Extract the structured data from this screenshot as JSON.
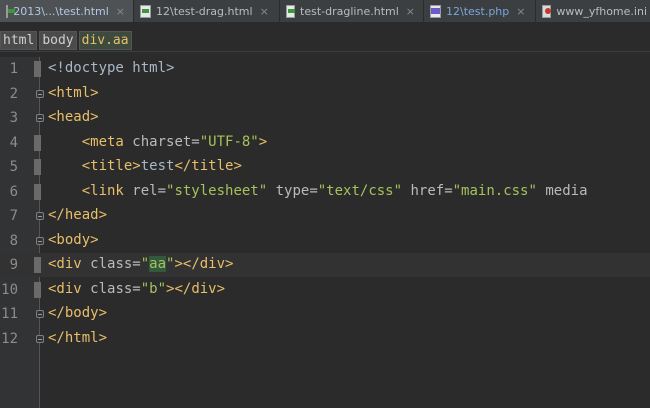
{
  "tabs": [
    {
      "label": "2013\\...\\test.html",
      "icon": "html-file-icon",
      "active": true
    },
    {
      "label": "12\\test-drag.html",
      "icon": "html-file-icon",
      "active": false
    },
    {
      "label": "test-dragline.html",
      "icon": "html-file-icon",
      "active": false
    },
    {
      "label": "12\\test.php",
      "icon": "php-file-icon",
      "active": false
    },
    {
      "label": "www_yfhome.ini",
      "icon": "web-file-icon",
      "active": false
    }
  ],
  "close_glyph": "×",
  "breadcrumb": [
    "html",
    "body",
    "div.aa"
  ],
  "code_lines": [
    {
      "n": "1",
      "parts": [
        [
          "txt",
          "<!doctype html>"
        ]
      ]
    },
    {
      "n": "2",
      "parts": [
        [
          "tag",
          "<html>"
        ]
      ]
    },
    {
      "n": "3",
      "parts": [
        [
          "tag",
          "<head>"
        ]
      ]
    },
    {
      "n": "4",
      "parts": [
        [
          "txt",
          "    "
        ],
        [
          "tag",
          "<meta "
        ],
        [
          "attr",
          "charset="
        ],
        [
          "val",
          "\"UTF-8\""
        ],
        [
          "tag",
          ">"
        ]
      ]
    },
    {
      "n": "5",
      "parts": [
        [
          "txt",
          "    "
        ],
        [
          "tag",
          "<title>"
        ],
        [
          "txt",
          "test"
        ],
        [
          "tag",
          "</title>"
        ]
      ]
    },
    {
      "n": "6",
      "parts": [
        [
          "txt",
          "    "
        ],
        [
          "tag",
          "<link "
        ],
        [
          "attr",
          "rel="
        ],
        [
          "val",
          "\"stylesheet\""
        ],
        [
          "attr",
          " type="
        ],
        [
          "val",
          "\"text/css\""
        ],
        [
          "attr",
          " href="
        ],
        [
          "val",
          "\"main.css\""
        ],
        [
          "attr",
          " media"
        ]
      ]
    },
    {
      "n": "7",
      "parts": [
        [
          "tag",
          "</head>"
        ]
      ]
    },
    {
      "n": "8",
      "parts": [
        [
          "tag",
          "<body>"
        ]
      ]
    },
    {
      "n": "9",
      "parts": [
        [
          "tag",
          "<div "
        ],
        [
          "attr",
          "class="
        ],
        [
          "val",
          "\""
        ],
        [
          "hl",
          "aa"
        ],
        [
          "val",
          "\""
        ],
        [
          "tag",
          "></div>"
        ]
      ]
    },
    {
      "n": "10",
      "parts": [
        [
          "tag",
          "<div "
        ],
        [
          "attr",
          "class="
        ],
        [
          "val",
          "\"b\""
        ],
        [
          "tag",
          "></div>"
        ]
      ]
    },
    {
      "n": "11",
      "parts": [
        [
          "tag",
          "</body>"
        ]
      ]
    },
    {
      "n": "12",
      "parts": [
        [
          "tag",
          "</html>"
        ]
      ]
    }
  ],
  "colors": {
    "background": "#2b2b2b",
    "tag": "#e8bf6a",
    "attribute": "#bababa",
    "value": "#a5c25c",
    "text": "#a9b7c6",
    "current_line": "#323232"
  }
}
